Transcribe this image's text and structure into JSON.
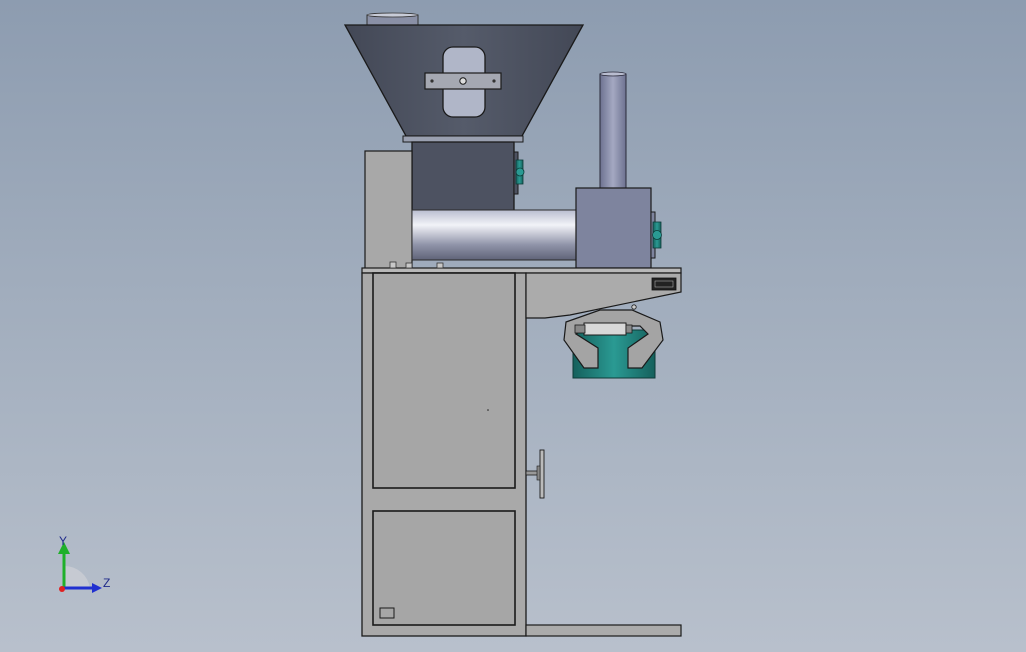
{
  "viewport": {
    "background_top": "#8d9cb0",
    "background_bottom": "#b8c0cc"
  },
  "triad": {
    "y_label": "Y",
    "z_label": "Z",
    "y_color": "#1fb02a",
    "z_color": "#2030d0",
    "x_color": "#e02020"
  },
  "model": {
    "frame_color": "#a9a9a9",
    "hopper_color": "#4a4f5c",
    "auger_color": "#9aa0b4",
    "teal_color": "#1f7f7a"
  }
}
